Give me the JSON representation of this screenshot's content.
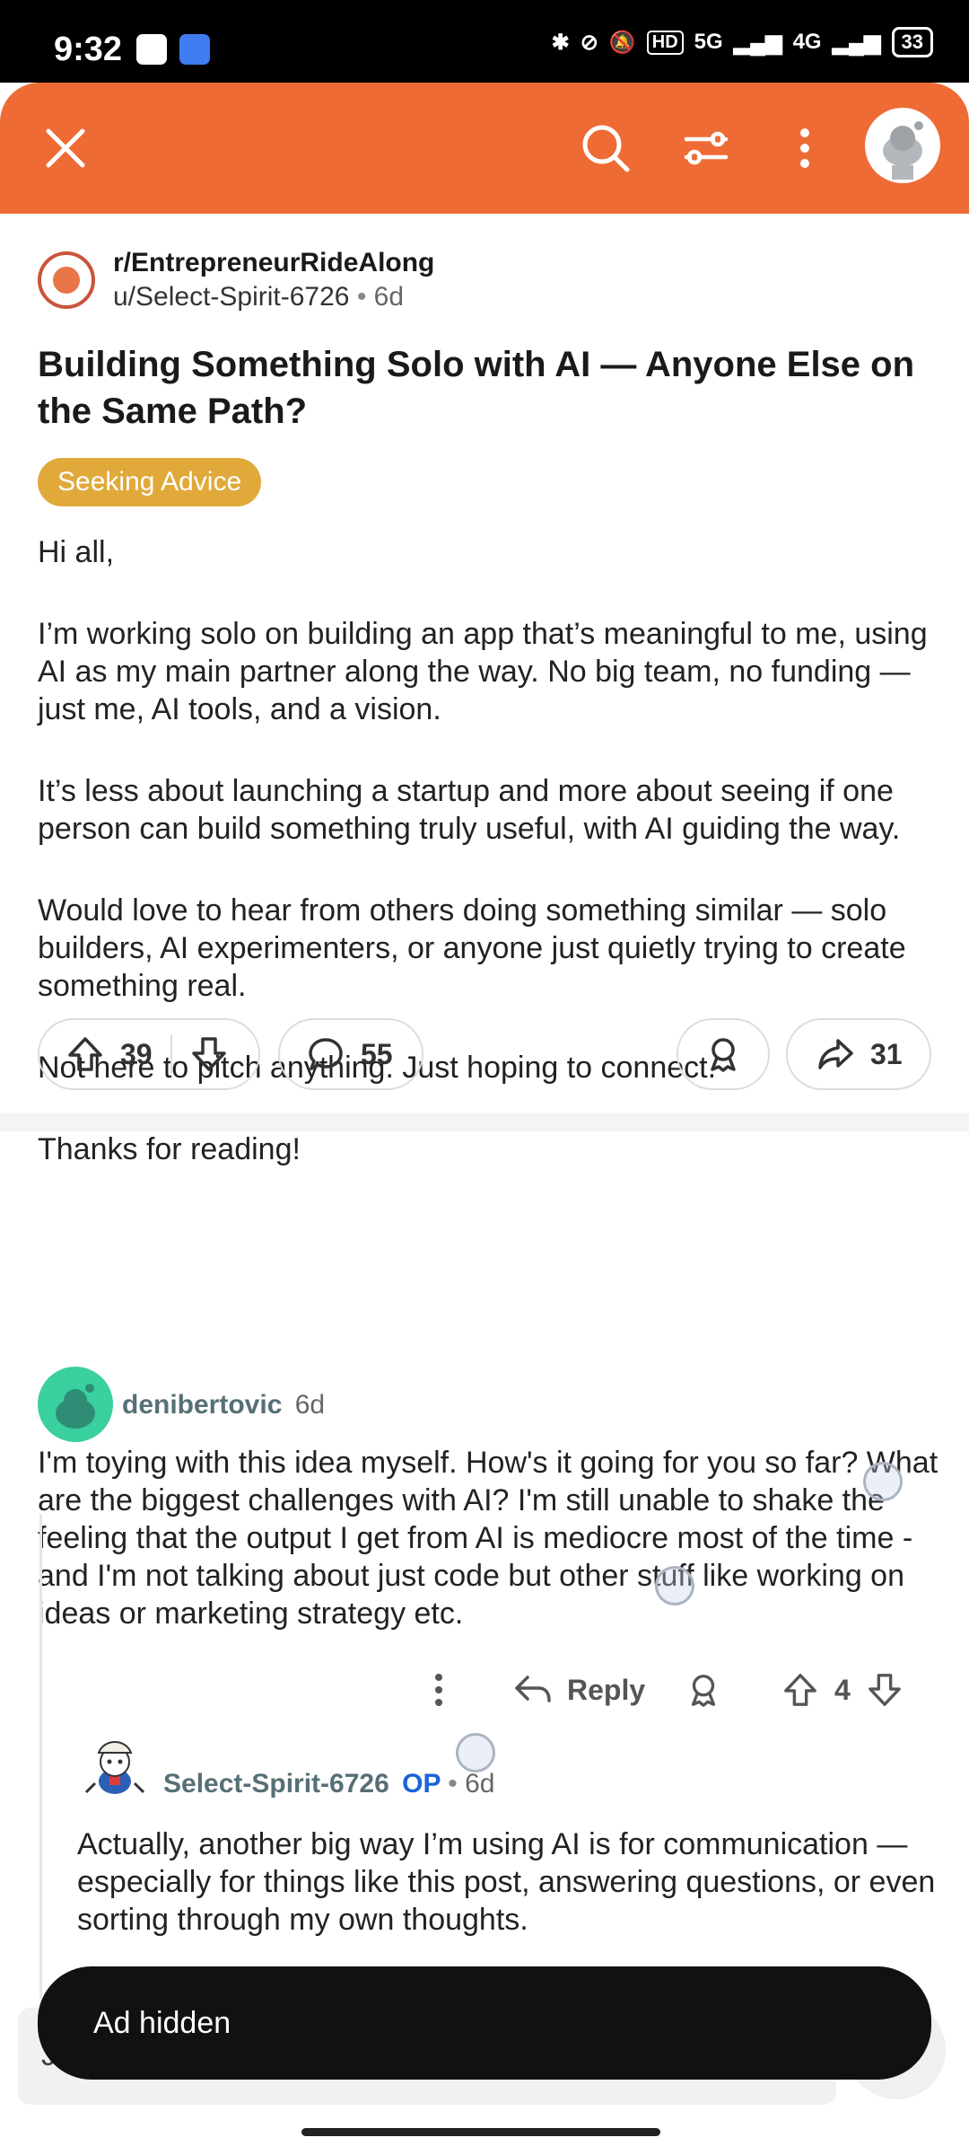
{
  "status_bar": {
    "time": "9:32",
    "hd_badge": "HD",
    "net1": "5G",
    "net2": "4G",
    "battery": "33"
  },
  "toolbar": {
    "close_icon": "close-icon",
    "search_icon": "search-icon",
    "filter_icon": "sort-filter-icon",
    "more_icon": "more-vertical-icon",
    "accent_color": "#ee6b35"
  },
  "post": {
    "subreddit": "r/EntrepreneurRideAlong",
    "author": "u/Select-Spirit-6726",
    "age": "6d",
    "title": "Building Something Solo with AI — Anyone Else on the Same Path?",
    "flair": "Seeking Advice",
    "body": [
      "Hi all,",
      "I’m working solo on building an app that’s meaningful to me, using AI as my main partner along the way. No big team, no funding — just me, AI tools, and a vision.",
      "It’s less about launching a startup and more about seeing if one person can build something truly useful, with AI guiding the way.",
      "Would love to hear from others doing something similar — solo builders, AI experimenters, or anyone just quietly trying to create something real.",
      "Not here to pitch anything. Just hoping to connect.",
      "Thanks for reading!"
    ],
    "upvotes": "39",
    "comments": "55",
    "shares": "31"
  },
  "comments": [
    {
      "author": "denibertovic",
      "age": "6d",
      "body": "I'm toying with this idea myself. How's it going for you so far? What are the biggest challenges with AI? I'm still unable to shake the feeling that the output I get from AI is mediocre most of the time - and I'm not talking about just code but other stuff like working on ideas or marketing strategy etc.",
      "reply_label": "Reply",
      "votes": "4"
    },
    {
      "author": "Select-Spirit-6726",
      "op_label": "OP",
      "age": "6d",
      "body": "Actually, another big way I’m using AI is for communication — especially for things like this post, answering questions, or even sorting through my own thoughts."
    }
  ],
  "composer": {
    "placeholder_fragment": "J"
  },
  "toast": {
    "message": "Ad hidden"
  }
}
